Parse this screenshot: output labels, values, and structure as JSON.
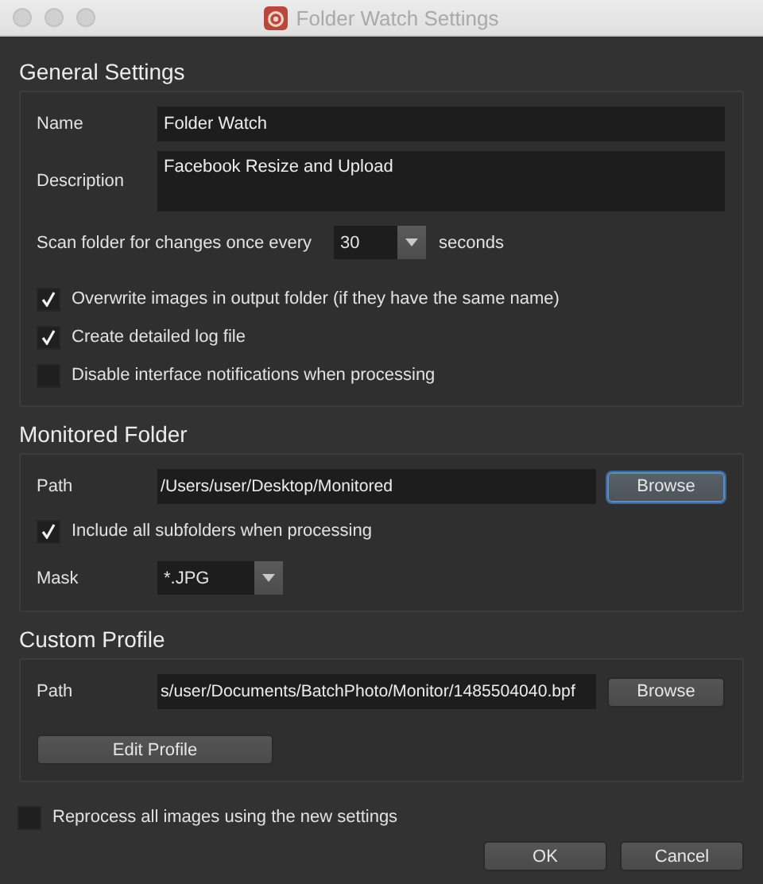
{
  "window": {
    "title": "Folder Watch Settings"
  },
  "sections": [
    {
      "title": "General Settings",
      "rows": [
        {
          "kind": "text",
          "label": "Name",
          "value": "Folder Watch"
        },
        {
          "kind": "textarea",
          "label": "Description",
          "value": "Facebook Resize and Upload"
        },
        {
          "kind": "interval",
          "label": "Scan folder for changes once every",
          "value": "30",
          "unit": "seconds"
        },
        {
          "kind": "checkbox",
          "label": "Overwrite images in output folder (if they have the same name)",
          "checked": true
        },
        {
          "kind": "checkbox",
          "label": "Create detailed log file",
          "checked": true
        },
        {
          "kind": "checkbox",
          "label": "Disable interface notifications when processing",
          "checked": false
        }
      ]
    },
    {
      "title": "Monitored Folder",
      "rows": [
        {
          "kind": "path",
          "label": "Path",
          "value": "/Users/user/Desktop/Monitored",
          "button": {
            "label": "Browse",
            "focused": true
          }
        },
        {
          "kind": "checkbox",
          "label": "Include all subfolders when processing",
          "checked": true
        },
        {
          "kind": "combo",
          "label": "Mask",
          "value": "*.JPG"
        }
      ]
    },
    {
      "title": "Custom Profile",
      "rows": [
        {
          "kind": "path",
          "label": "Path",
          "value": "s/user/Documents/BatchPhoto/Monitor/1485504040.bpf",
          "button": {
            "label": "Browse",
            "focused": false
          }
        },
        {
          "kind": "button",
          "label": "Edit Profile"
        }
      ]
    }
  ],
  "footer": {
    "checkbox": {
      "label": "Reprocess all images using the new settings",
      "checked": false
    },
    "buttons": [
      {
        "label": "OK"
      },
      {
        "label": "Cancel"
      }
    ]
  }
}
